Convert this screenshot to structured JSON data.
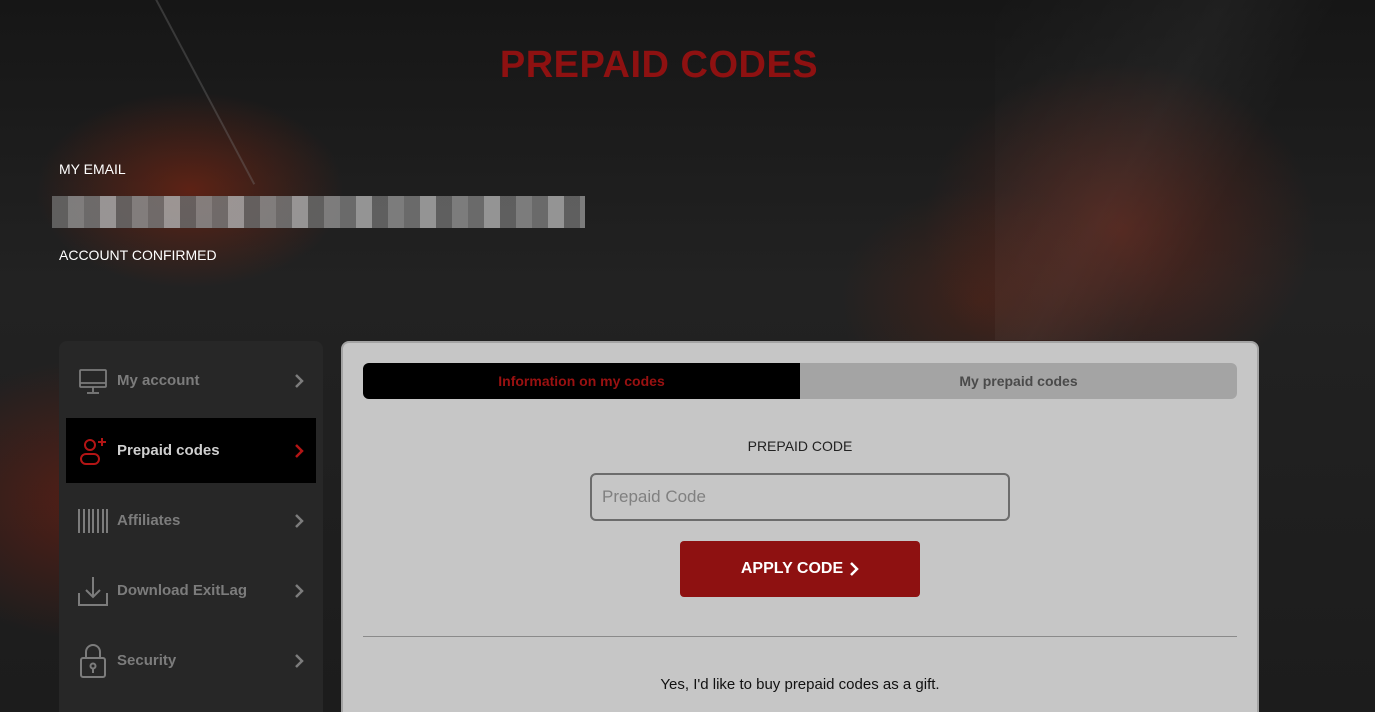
{
  "page": {
    "title": "PREPAID CODES"
  },
  "account": {
    "email_label": "MY EMAIL",
    "email_value": "",
    "status": "ACCOUNT CONFIRMED"
  },
  "sidebar": {
    "items": [
      {
        "label": "My account",
        "icon": "monitor-icon",
        "active": false
      },
      {
        "label": "Prepaid codes",
        "icon": "add-user-icon",
        "active": true
      },
      {
        "label": "Affiliates",
        "icon": "barcode-icon",
        "active": false
      },
      {
        "label": "Download ExitLag",
        "icon": "download-icon",
        "active": false
      },
      {
        "label": "Security",
        "icon": "lock-icon",
        "active": false
      }
    ]
  },
  "main": {
    "tabs": [
      {
        "label": "Information on my codes",
        "active": true
      },
      {
        "label": "My prepaid codes",
        "active": false
      }
    ],
    "code_field": {
      "label": "PREPAID CODE",
      "placeholder": "Prepaid Code",
      "value": ""
    },
    "apply_button": "APPLY CODE",
    "gift_text": "Yes, I'd like to buy prepaid codes as a gift."
  },
  "colors": {
    "accent": "#8e1111",
    "panel_bg": "#c6c6c6",
    "sidebar_bg": "#272727"
  }
}
